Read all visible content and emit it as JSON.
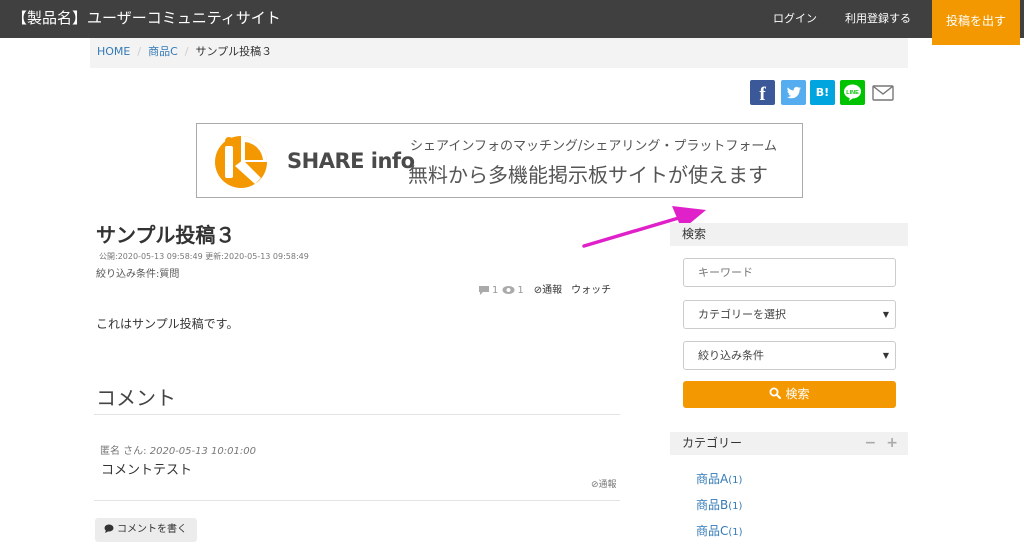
{
  "header": {
    "site_title": "【製品名】ユーザーコミュニティサイト",
    "login_label": "ログイン",
    "register_label": "利用登録する",
    "post_button_label": "投稿を出す"
  },
  "breadcrumb": {
    "home": "HOME",
    "category": "商品C",
    "current": "サンプル投稿３",
    "separator": "/"
  },
  "share": {
    "facebook_glyph": "f",
    "hatena_glyph": "B!",
    "colors": {
      "facebook": "#3b5998",
      "twitter": "#55acee",
      "hatena": "#00a4de",
      "line": "#00c300"
    }
  },
  "banner": {
    "brand": "SHARE info",
    "subtitle": "シェアインフォのマッチング/シェアリング・プラットフォーム",
    "tagline": "無料から多機能掲示板サイトが使えます"
  },
  "post": {
    "title": "サンプル投稿３",
    "dates": "公開:2020-05-13 09:58:49 更新:2020-05-13 09:58:49",
    "filter": "絞り込み条件:質問",
    "comment_count": "1",
    "view_count": "1",
    "report_label": "⊘通報",
    "watch_label": "ウォッチ",
    "body": "これはサンプル投稿です。"
  },
  "comments": {
    "heading": "コメント",
    "items": [
      {
        "author": "匿名 さん:",
        "date": "2020-05-13 10:01:00",
        "text": "コメントテスト",
        "report_label": "⊘通報"
      }
    ],
    "write_label": "コメントを書く"
  },
  "sidebar": {
    "search_heading": "検索",
    "keyword_placeholder": "キーワード",
    "category_select": "カテゴリーを選択",
    "filter_select": "絞り込み条件",
    "search_button": "検索",
    "categories_heading": "カテゴリー",
    "collapse_label": "−",
    "expand_label": "+",
    "categories": [
      {
        "name": "商品A",
        "count": "(1)"
      },
      {
        "name": "商品B",
        "count": "(1)"
      },
      {
        "name": "商品C",
        "count": "(1)"
      }
    ]
  },
  "colors": {
    "header_bg": "#404040",
    "accent_orange": "#f39800",
    "link_blue": "#337ab7",
    "annotation_arrow": "#e020c8"
  }
}
